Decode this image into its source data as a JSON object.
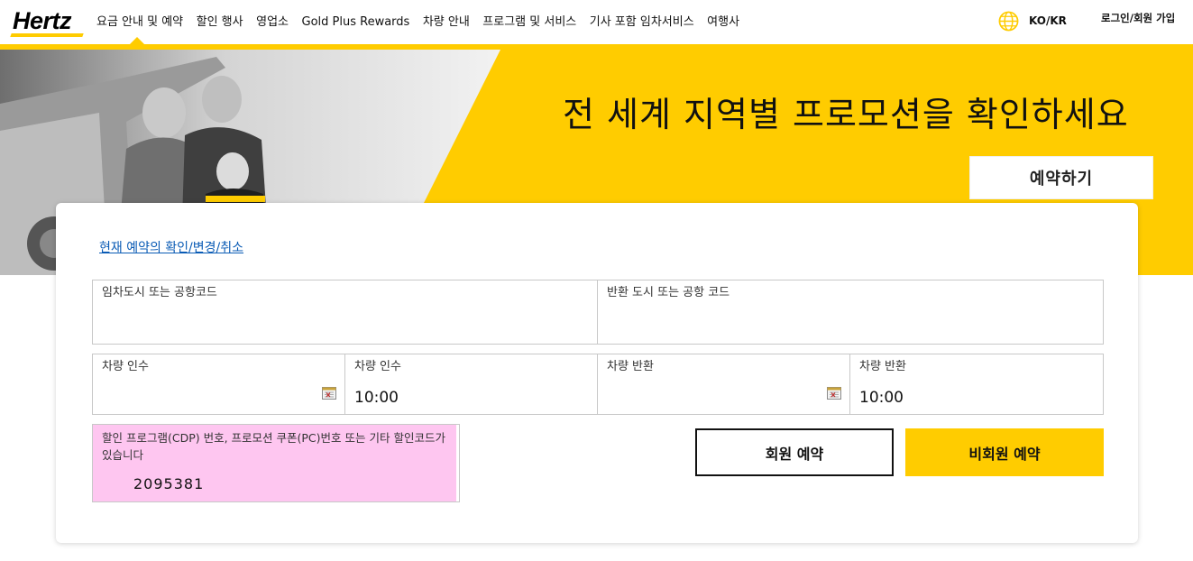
{
  "header": {
    "logo": "Hertz",
    "nav": [
      {
        "label": "요금 안내 및 예약"
      },
      {
        "label": "할인 행사"
      },
      {
        "label": "영업소"
      },
      {
        "label": "Gold Plus Rewards"
      },
      {
        "label": "차량 안내"
      },
      {
        "label": "프로그램 및 서비스"
      },
      {
        "label": "기사 포함 임차서비스"
      },
      {
        "label": "여행사"
      }
    ],
    "language": "KO/KR",
    "login": "로그인/회원 가입"
  },
  "hero": {
    "title": "전 세계 지역별 프로모션을 확인하세요",
    "cta": "예약하기"
  },
  "booking": {
    "manage_link": "현재 예약의 확인/변경/취소",
    "pickup_location_label": "임차도시 또는 공항코드",
    "pickup_location_value": "",
    "return_location_label": "반환 도시 또는 공항 코드",
    "return_location_value": "",
    "pickup_date_label": "차량 인수",
    "pickup_date_value": "",
    "pickup_time_label": "차량 인수",
    "pickup_time_value": "10:00",
    "return_date_label": "차량 반환",
    "return_date_value": "",
    "return_time_label": "차량 반환",
    "return_time_value": "10:00",
    "discount_label": "할인 프로그램(CDP) 번호, 프로모션 쿠폰(PC)번호 또는 기타 할인코드가 있습니다",
    "discount_value": "2095381",
    "member_button": "회원 예약",
    "guest_button": "비회원 예약"
  },
  "colors": {
    "brand_yellow": "#FFCC00",
    "link_blue": "#0A5BB5",
    "highlight_pink": "#FEC6F0"
  }
}
